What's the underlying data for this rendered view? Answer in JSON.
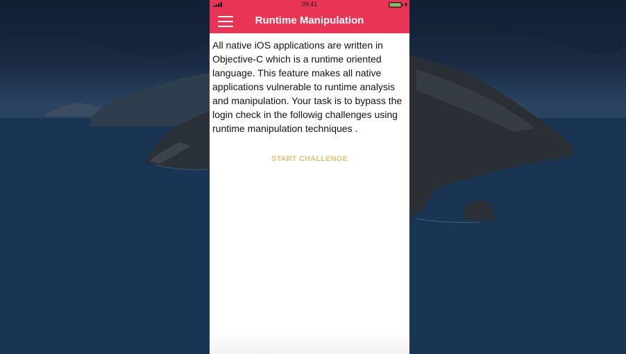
{
  "status_bar": {
    "time": "09:41",
    "signal_icon": "signal-bars-icon",
    "battery_icon": "battery-icon",
    "charging_icon": "charging-bolt-icon",
    "battery_color": "#4cd964"
  },
  "nav_bar": {
    "title": "Runtime Manipulation",
    "menu_icon": "hamburger-menu-icon",
    "background_color": "#e83455"
  },
  "content": {
    "description": "All native iOS applications are written in Objective-C which is a runtime oriented language. This feature makes all native applications vulnerable to runtime analysis and manipulation. Your task is to bypass the login check in the followig challenges using runtime manipulation techniques ."
  },
  "actions": {
    "start_challenge_label": "START CHALLENGE",
    "start_challenge_color": "#e8c27a"
  },
  "desktop": {
    "wallpaper": "coastal-island-night-wallpaper"
  }
}
